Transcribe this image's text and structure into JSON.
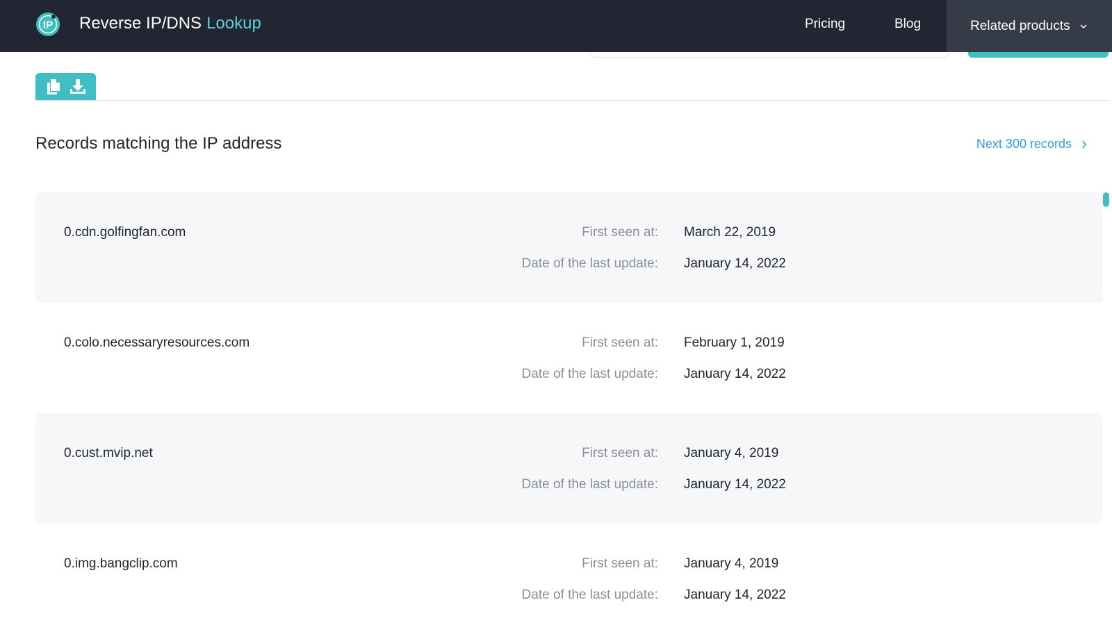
{
  "header": {
    "brand_main": "Reverse IP/DNS",
    "brand_accent": "Lookup",
    "logo_text": "IP",
    "nav": {
      "pricing": "Pricing",
      "blog": "Blog",
      "related": "Related products"
    }
  },
  "toolbar": {
    "copy_icon": "copy-icon",
    "download_icon": "download-icon"
  },
  "section": {
    "title": "Records matching the IP address",
    "next_link": "Next 300 records"
  },
  "labels": {
    "first_seen": "First seen at:",
    "last_update": "Date of the last update:"
  },
  "records": [
    {
      "domain": "0.cdn.golfingfan.com",
      "first_seen": "March 22, 2019",
      "last_update": "January 14, 2022"
    },
    {
      "domain": "0.colo.necessaryresources.com",
      "first_seen": "February 1, 2019",
      "last_update": "January 14, 2022"
    },
    {
      "domain": "0.cust.mvip.net",
      "first_seen": "January 4, 2019",
      "last_update": "January 14, 2022"
    },
    {
      "domain": "0.img.bangclip.com",
      "first_seen": "January 4, 2019",
      "last_update": "January 14, 2022"
    }
  ],
  "colors": {
    "header_bg": "#222632",
    "accent": "#3fbfc3",
    "link": "#2f9fd8",
    "row_shade": "#f6f7f9"
  }
}
